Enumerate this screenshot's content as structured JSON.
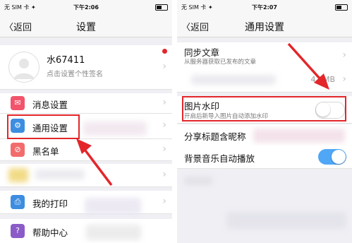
{
  "left": {
    "status": {
      "carrier": "无 SIM 卡 ✦",
      "time": "下午2:06",
      "battery": ""
    },
    "nav": {
      "back": "〈返回",
      "title": "设置"
    },
    "profile": {
      "name": "水67411",
      "subtitle": "点击设置个性签名"
    },
    "items": [
      {
        "label": "消息设置"
      },
      {
        "label": "通用设置"
      },
      {
        "label": "黑名单"
      },
      {
        "label": "我的打印"
      },
      {
        "label": "帮助中心"
      }
    ]
  },
  "right": {
    "status": {
      "carrier": "无 SIM 卡 ✦",
      "time": "下午2:07",
      "battery": ""
    },
    "nav": {
      "back": "〈返回",
      "title": "通用设置"
    },
    "items": [
      {
        "label": "同步文章",
        "sub": "从服务器获取已发布的文章"
      },
      {
        "value": "4.6MB"
      },
      {
        "label": "图片水印",
        "sub": "开启后新导入图片自动添加水印",
        "toggle": false
      },
      {
        "label": "分享标题含昵称"
      },
      {
        "label": "背景音乐自动播放",
        "toggle": true
      }
    ]
  },
  "colors": {
    "accent": "#4fa7f6",
    "highlight": "#e3262a",
    "badge": "#e3262a"
  }
}
